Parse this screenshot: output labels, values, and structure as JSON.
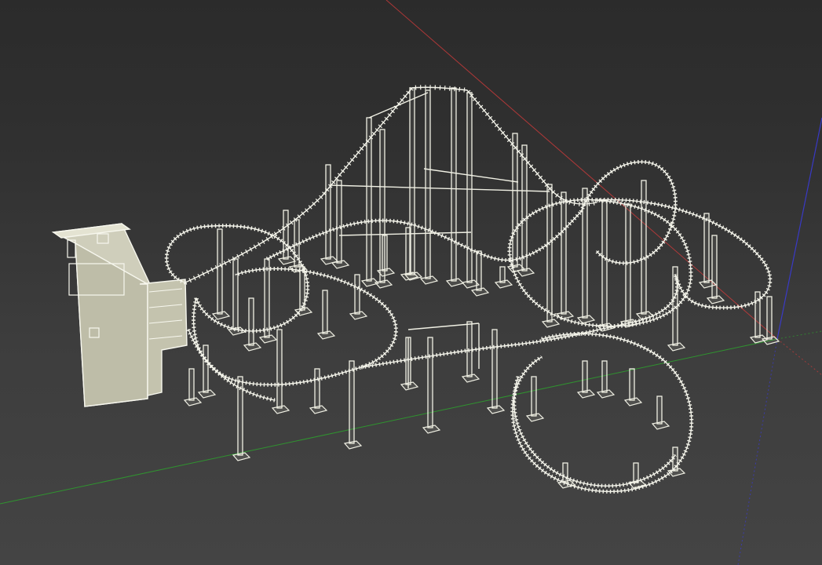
{
  "app": {
    "title": "",
    "view": "perspective-3d-viewport"
  },
  "scene": {
    "model": "roller-coaster",
    "render_mode": "wireframe",
    "colors": {
      "background_top": "#2b2b2b",
      "background_bottom": "#444444",
      "model_edge": "#f4f4ea",
      "station_fill": "#c9c8b4",
      "axis_x": "#c63a3a",
      "axis_y": "#2e9d2e",
      "axis_z": "#3a3ad6"
    },
    "axes": {
      "x_label": "",
      "y_label": "",
      "z_label": ""
    },
    "icons": [
      "station-icon",
      "track-icon",
      "support-icon"
    ]
  }
}
